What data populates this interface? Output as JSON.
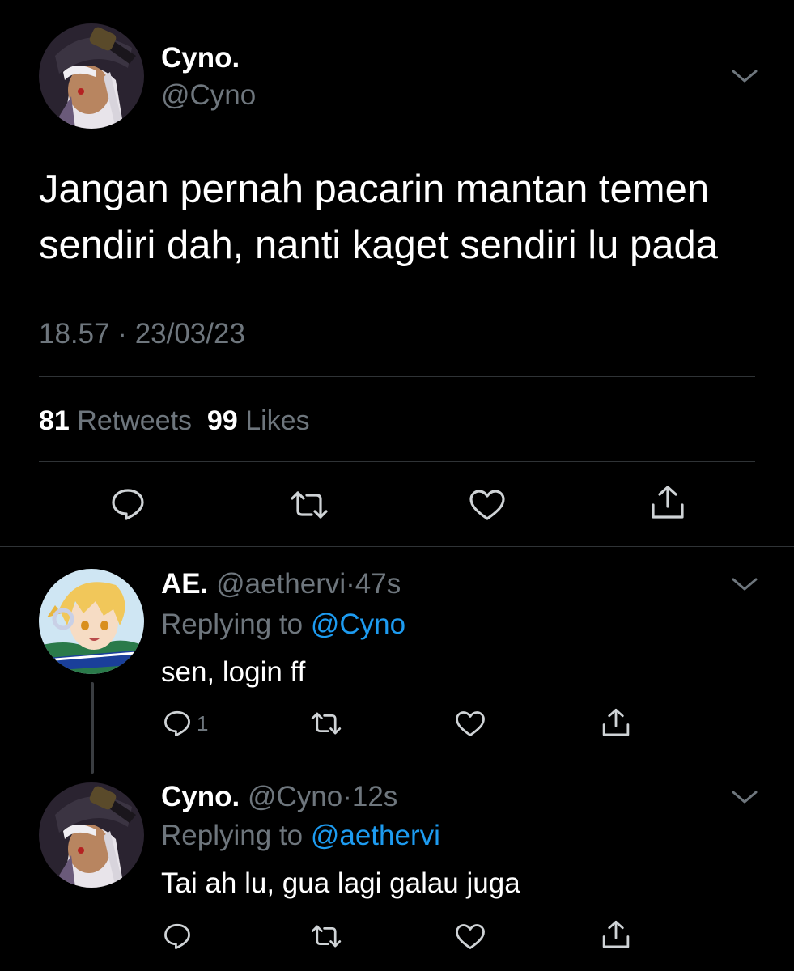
{
  "main_tweet": {
    "name": "Cyno.",
    "handle": "@Cyno",
    "text_line1": "Jangan pernah pacarin mantan temen",
    "text_line2": "sendiri dah, nanti kaget sendiri lu pada",
    "timestamp": "18.57 · 23/03/23",
    "retweets_count": "81",
    "retweets_label": "Retweets",
    "likes_count": "99",
    "likes_label": "Likes",
    "avatar_icon": "cyno-avatar"
  },
  "replies": [
    {
      "name": "AE.",
      "handle": "@aethervi",
      "time": "47s",
      "replying_prefix": "Replying to",
      "replying_to": "@Cyno",
      "text": "sen, login ff",
      "reply_count": "1",
      "avatar_icon": "aether-avatar"
    },
    {
      "name": "Cyno.",
      "handle": "@Cyno",
      "time": "12s",
      "replying_prefix": "Replying to",
      "replying_to": "@aethervi",
      "text": "Tai ah lu, gua lagi galau juga",
      "reply_count": "",
      "avatar_icon": "cyno-avatar"
    }
  ],
  "colors": {
    "background": "#000000",
    "text": "#ffffff",
    "muted": "#6e767d",
    "link": "#1d9bf0",
    "divider": "#2f3336"
  },
  "icons": {
    "reply": "reply-icon",
    "retweet": "retweet-icon",
    "like": "heart-icon",
    "share": "share-icon",
    "more": "chevron-down-icon"
  }
}
